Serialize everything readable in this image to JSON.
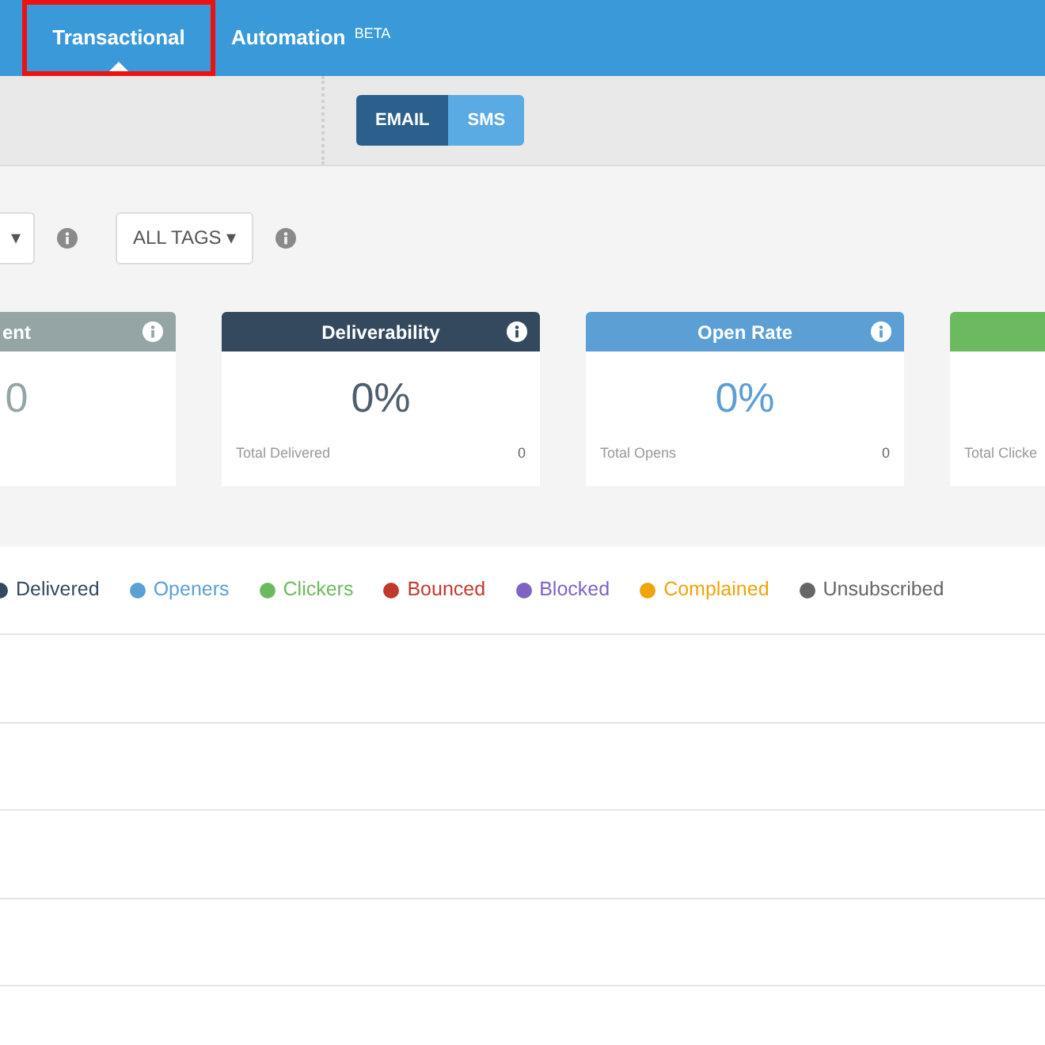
{
  "tabs": [
    {
      "label": "Transactional",
      "selected": true
    },
    {
      "label": "Automation $^{BETA}$",
      "selected": false
    }
  ],
  "channel_toggle": [
    {
      "label": "EMAIL",
      "selected": true
    },
    {
      "label": "SMS",
      "selected": false
    }
  ],
  "filters": [
    {
      "caret": "▾"
    },
    {
      "label": "ALL TAGS",
      "caret": "▾"
    }
  ],
  "cards": [
    {
      "title": "ent",
      "value": "0",
      "color": "#95a5a6"
    },
    {
      "title": "Deliverability",
      "value": "0%",
      "footer_label": "Total Delivered",
      "footer_value": "0",
      "color": "#34495e"
    },
    {
      "title": "Open Rate",
      "value": "0%",
      "footer_label": "Total Opens",
      "footer_value": "0",
      "color": "#5b9fd4"
    },
    {
      "footer_label": "Total Clicke",
      "color": "#6cba5f"
    }
  ],
  "legend": [
    {
      "label": "Delivered",
      "color": "#34495e"
    },
    {
      "label": "Openers",
      "color": "#5b9fd4"
    },
    {
      "label": "Clickers",
      "color": "#6cba5f"
    },
    {
      "label": "Bounced",
      "color": "#c0392b"
    },
    {
      "label": "Blocked",
      "color": "#7e62c4"
    },
    {
      "label": "Complained",
      "color": "#f0a30a"
    },
    {
      "label": "Unsubscribed",
      "color": "#666666"
    }
  ]
}
